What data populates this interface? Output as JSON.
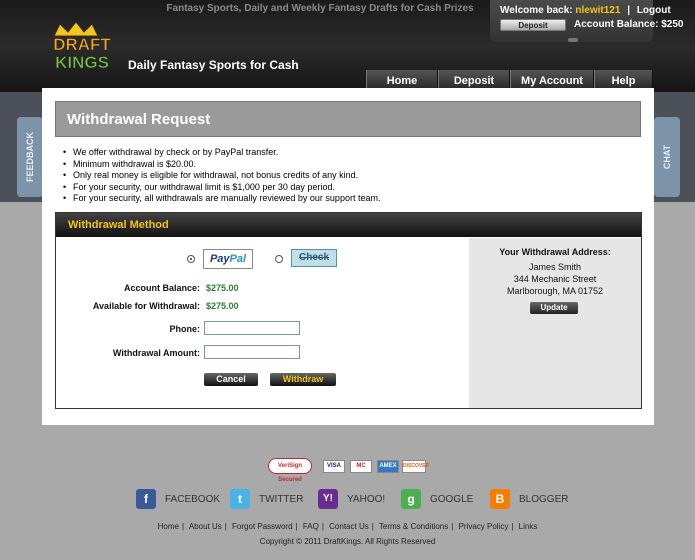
{
  "header": {
    "tagline": "Fantasy Sports, Daily and Weekly Fantasy Drafts for Cash Prizes",
    "welcome_prefix": "Welcome back:",
    "username": "nlewit121",
    "separator": "|",
    "logout": "Logout",
    "deposit_button": "Deposit",
    "balance_label": "Account Balance:",
    "balance_value": "$250",
    "logo_top": "DRAFT",
    "logo_bottom": "KINGS",
    "site_title": "Daily Fantasy Sports for Cash"
  },
  "nav": [
    {
      "label": "Home"
    },
    {
      "label": "Deposit"
    },
    {
      "label": "My Account"
    },
    {
      "label": "Help"
    }
  ],
  "side_tabs": {
    "feedback": "FEEDBACK",
    "chat": "CHAT"
  },
  "page": {
    "title": "Withdrawal Request",
    "notes": [
      "We offer withdrawal by check or by PayPal transfer.",
      "Minimum withdrawal is $20.00.",
      "Only real money is eligible for withdrawal, not bonus credits of any kind.",
      "For your security, our withdrawal limit is $1,000 per 30 day period.",
      "For your security, all withdrawals are manually reviewed by our support team."
    ]
  },
  "method": {
    "title": "Withdrawal Method",
    "paypal_a": "Pay",
    "paypal_b": "Pal",
    "check": "Check",
    "selected": "paypal",
    "account_balance_label": "Account Balance:",
    "account_balance_value": "$275.00",
    "available_label": "Available for Withdrawal:",
    "available_value": "$275.00",
    "phone_label": "Phone:",
    "phone_value": "",
    "amount_label": "Withdrawal Amount:",
    "amount_value": "",
    "cancel_button": "Cancel",
    "withdraw_button": "Withdraw"
  },
  "address": {
    "title": "Your Withdrawal Address:",
    "name": "James Smith",
    "street": "344 Mechanic Street",
    "city": "Marlborough, MA 01752",
    "update_button": "Update"
  },
  "footer": {
    "verisign": "VeriSign Secured",
    "cards": [
      "VISA",
      "MC",
      "AMEX",
      "DISCOVER"
    ],
    "social": [
      {
        "name": "FACEBOOK",
        "icon": "f",
        "color": "#3b5998"
      },
      {
        "name": "TWITTER",
        "icon": "t",
        "color": "#4ab3e6"
      },
      {
        "name": "YAHOO!",
        "icon": "Y!",
        "color": "#6b2c91"
      },
      {
        "name": "GOOGLE",
        "icon": "g",
        "color": "#4caf50"
      },
      {
        "name": "BLOGGER",
        "icon": "B",
        "color": "#f57d00"
      }
    ],
    "links": [
      "Home",
      "About Us",
      "Forgot Password",
      "FAQ",
      "Contact Us",
      "Terms & Conditions",
      "Privacy Policy",
      "Links"
    ],
    "copyright": "Copyright © 2011 DraftKings. All Rights Reserved"
  },
  "colors": {
    "accent": "#f5c518",
    "money_green": "#2e7d32",
    "side_tab": "#7c93aa"
  }
}
